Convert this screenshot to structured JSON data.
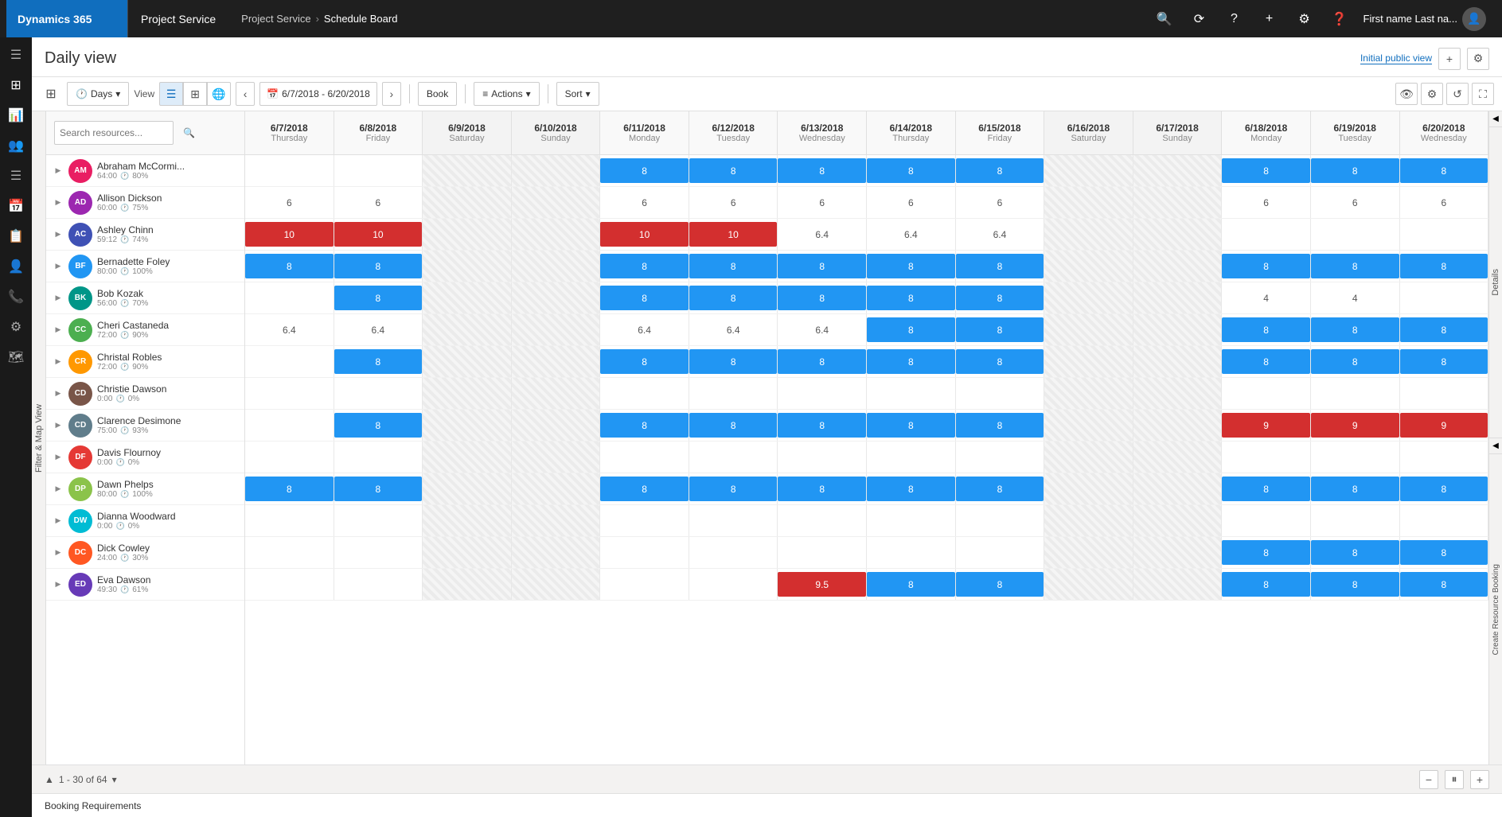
{
  "app": {
    "brand": "Dynamics 365",
    "module": "Project Service",
    "breadcrumb": [
      "Project Service",
      "Schedule Board"
    ],
    "user": "First name Last na...",
    "page_title": "Daily view",
    "initial_view_label": "Initial public view"
  },
  "toolbar": {
    "days_label": "Days",
    "view_label": "View",
    "date_range": "6/7/2018 - 6/20/2018",
    "book_label": "Book",
    "actions_label": "Actions",
    "sort_label": "Sort",
    "search_placeholder": "Search resources..."
  },
  "columns": [
    {
      "date": "6/7/2018",
      "day": "Thursday",
      "weekend": false
    },
    {
      "date": "6/8/2018",
      "day": "Friday",
      "weekend": false
    },
    {
      "date": "6/9/2018",
      "day": "Saturday",
      "weekend": true
    },
    {
      "date": "6/10/2018",
      "day": "Sunday",
      "weekend": true
    },
    {
      "date": "6/11/2018",
      "day": "Monday",
      "weekend": false
    },
    {
      "date": "6/12/2018",
      "day": "Tuesday",
      "weekend": false
    },
    {
      "date": "6/13/2018",
      "day": "Wednesday",
      "weekend": false
    },
    {
      "date": "6/14/2018",
      "day": "Thursday",
      "weekend": false
    },
    {
      "date": "6/15/2018",
      "day": "Friday",
      "weekend": false
    },
    {
      "date": "6/16/2018",
      "day": "Saturday",
      "weekend": true
    },
    {
      "date": "6/17/2018",
      "day": "Sunday",
      "weekend": true
    },
    {
      "date": "6/18/2018",
      "day": "Monday",
      "weekend": false
    },
    {
      "date": "6/19/2018",
      "day": "Tuesday",
      "weekend": false
    },
    {
      "date": "6/20/2018",
      "day": "Wednesday",
      "weekend": false
    }
  ],
  "resources": [
    {
      "name": "Abraham McCormi...",
      "hours": "64:00",
      "utilization": "80%",
      "bookings": [
        null,
        null,
        null,
        null,
        "8b",
        "8b",
        "8b",
        "8b",
        "8b",
        null,
        null,
        "8b",
        "8b",
        "8b"
      ]
    },
    {
      "name": "Allison Dickson",
      "hours": "60:00",
      "utilization": "75%",
      "bookings": [
        "6",
        "6",
        null,
        null,
        "6",
        "6",
        "6",
        "6",
        "6",
        null,
        null,
        "6",
        "6",
        "6"
      ]
    },
    {
      "name": "Ashley Chinn",
      "hours": "59:12",
      "utilization": "74%",
      "bookings": [
        "10r",
        "10r",
        null,
        null,
        "10r",
        "10r",
        "6.4",
        "6.4",
        "6.4",
        null,
        null,
        null,
        null,
        null
      ]
    },
    {
      "name": "Bernadette Foley",
      "hours": "80:00",
      "utilization": "100%",
      "bookings": [
        "8b",
        "8b",
        null,
        null,
        "8b",
        "8b",
        "8b",
        "8b",
        "8b",
        null,
        null,
        "8b",
        "8b",
        "8b"
      ]
    },
    {
      "name": "Bob Kozak",
      "hours": "56:00",
      "utilization": "70%",
      "bookings": [
        null,
        "8b",
        null,
        null,
        "8b",
        "8b",
        "8b",
        "8b",
        "8b",
        null,
        null,
        "4",
        "4",
        null
      ]
    },
    {
      "name": "Cheri Castaneda",
      "hours": "72:00",
      "utilization": "90%",
      "bookings": [
        "6.4",
        "6.4",
        null,
        null,
        "6.4",
        "6.4",
        "6.4",
        "8b",
        "8b",
        null,
        null,
        "8b",
        "8b",
        "8b"
      ]
    },
    {
      "name": "Christal Robles",
      "hours": "72:00",
      "utilization": "90%",
      "bookings": [
        null,
        "8b",
        null,
        null,
        "8b",
        "8b",
        "8b",
        "8b",
        "8b",
        null,
        null,
        "8b",
        "8b",
        "8b"
      ]
    },
    {
      "name": "Christie Dawson",
      "hours": "0:00",
      "utilization": "0%",
      "bookings": [
        null,
        null,
        null,
        null,
        null,
        null,
        null,
        null,
        null,
        null,
        null,
        null,
        null,
        null
      ]
    },
    {
      "name": "Clarence Desimone",
      "hours": "75:00",
      "utilization": "93%",
      "bookings": [
        null,
        "8b",
        null,
        null,
        "8b",
        "8b",
        "8b",
        "8b",
        "8b",
        null,
        null,
        "9r",
        "9r",
        "9r"
      ]
    },
    {
      "name": "Davis Flournoy",
      "hours": "0:00",
      "utilization": "0%",
      "bookings": [
        null,
        null,
        null,
        null,
        null,
        null,
        null,
        null,
        null,
        null,
        null,
        null,
        null,
        null
      ]
    },
    {
      "name": "Dawn Phelps",
      "hours": "80:00",
      "utilization": "100%",
      "bookings": [
        "8b",
        "8b",
        null,
        null,
        "8b",
        "8b",
        "8b",
        "8b",
        "8b",
        null,
        null,
        "8b",
        "8b",
        "8b"
      ]
    },
    {
      "name": "Dianna Woodward",
      "hours": "0:00",
      "utilization": "0%",
      "bookings": [
        null,
        null,
        null,
        null,
        null,
        null,
        null,
        null,
        null,
        null,
        null,
        null,
        null,
        null
      ]
    },
    {
      "name": "Dick Cowley",
      "hours": "24:00",
      "utilization": "30%",
      "bookings": [
        null,
        null,
        null,
        null,
        null,
        null,
        null,
        null,
        null,
        null,
        null,
        "8b",
        "8b",
        "8b"
      ]
    },
    {
      "name": "Eva Dawson",
      "hours": "49:30",
      "utilization": "61%",
      "bookings": [
        null,
        null,
        null,
        null,
        null,
        null,
        "9.5r",
        "8b",
        "8b",
        null,
        null,
        "8b",
        "8b",
        "8b"
      ]
    }
  ],
  "pagination": {
    "label": "1 - 30 of 64"
  },
  "bottom_section": "Booking Requirements",
  "colors": {
    "blue_booking": "#2196F3",
    "red_booking": "#d32f2f",
    "accent": "#106ebe",
    "nav_bg": "#1f1f1f",
    "sidebar_bg": "#1a1a1a"
  },
  "right_panels": {
    "details_label": "Details",
    "create_resource_label": "Create Resource Booking"
  }
}
